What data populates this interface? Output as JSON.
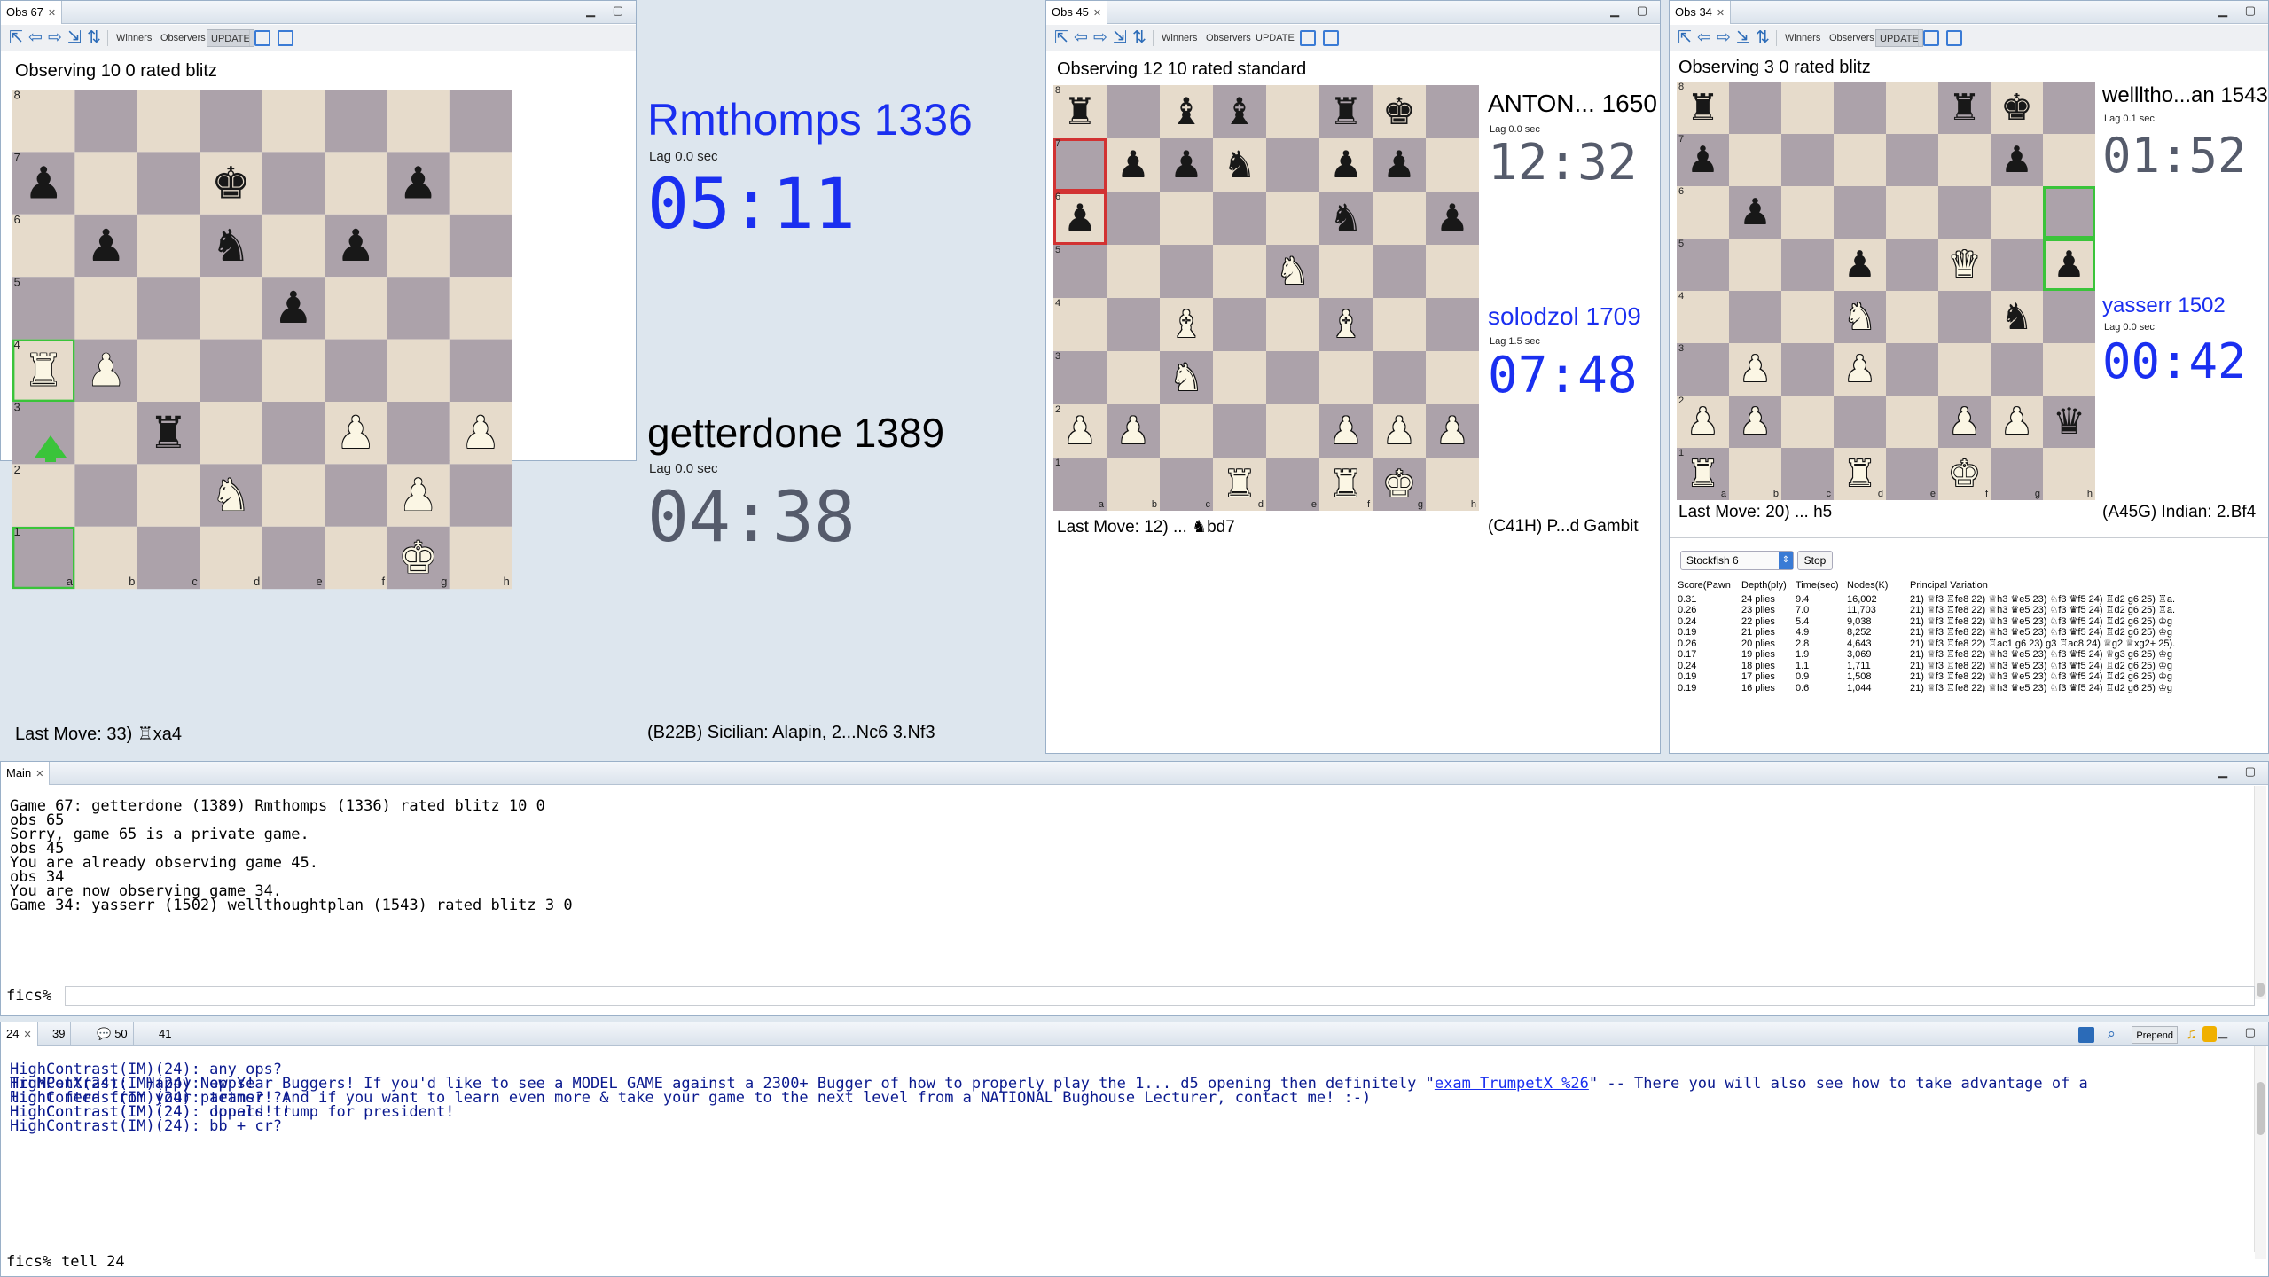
{
  "game1": {
    "tab_label": "Obs 67",
    "toolbar": {
      "winners": "Winners",
      "observers": "Observers",
      "update": "UPDATE"
    },
    "header": "Observing 10 0 rated blitz",
    "top_player": {
      "name": "Rmthomps 1336",
      "lag": "Lag 0.0 sec",
      "clock": "05:11"
    },
    "bottom_player": {
      "name": "getterdone 1389",
      "lag": "Lag 0.0 sec",
      "clock": "04:38"
    },
    "last_move": "Last Move: 33) ♖xa4",
    "opening": "(B22B) Sicilian: Alapin, 2...Nc6 3.Nf3",
    "board": [
      [
        "",
        "",
        "",
        "",
        "",
        "",
        "",
        ""
      ],
      [
        "p",
        "",
        "",
        "k",
        "",
        "",
        "p",
        ""
      ],
      [
        "",
        "p",
        "",
        "n",
        "",
        "p",
        "",
        ""
      ],
      [
        "",
        "",
        "",
        "",
        "p",
        "",
        "",
        ""
      ],
      [
        "R",
        "P",
        "",
        "",
        "",
        "",
        "",
        ""
      ],
      [
        "",
        "",
        "r",
        "",
        "",
        "P",
        "",
        "P"
      ],
      [
        "",
        "",
        "",
        "N",
        "",
        "",
        "P",
        ""
      ],
      [
        "",
        "",
        "",
        "",
        "",
        "",
        "K",
        ""
      ]
    ],
    "files": [
      "a",
      "b",
      "c",
      "d",
      "e",
      "f",
      "g",
      "h"
    ],
    "ranks": [
      "8",
      "7",
      "6",
      "5",
      "4",
      "3",
      "2",
      "1"
    ]
  },
  "game2": {
    "tab_label": "Obs 45",
    "toolbar": {
      "winners": "Winners",
      "observers": "Observers",
      "update": "UPDATE"
    },
    "header": "Observing 12 10 rated standard",
    "top_player": {
      "name": "ANTON... 1650",
      "lag": "Lag 0.0 sec",
      "clock": "12:32"
    },
    "bottom_player": {
      "name": "solodzol 1709",
      "lag": "Lag 1.5 sec",
      "clock": "07:48"
    },
    "last_move": "Last Move: 12) ... ♞bd7",
    "opening": "(C41H) P...d Gambit",
    "board": [
      [
        "r",
        "",
        "b",
        "b",
        "",
        "r",
        "k",
        ""
      ],
      [
        "",
        "p",
        "p",
        "n",
        "",
        "p",
        "p",
        ""
      ],
      [
        "p",
        "",
        "",
        "",
        "",
        "n",
        "",
        "p"
      ],
      [
        "",
        "",
        "",
        "",
        "N",
        "",
        "",
        ""
      ],
      [
        "",
        "",
        "B",
        "",
        "",
        "B",
        "",
        ""
      ],
      [
        "",
        "",
        "N",
        "",
        "",
        "",
        "",
        ""
      ],
      [
        "P",
        "P",
        "",
        "",
        "",
        "P",
        "P",
        "P"
      ],
      [
        "",
        "",
        "",
        "R",
        "",
        "R",
        "K",
        ""
      ]
    ],
    "files": [
      "a",
      "b",
      "c",
      "d",
      "e",
      "f",
      "g",
      "h"
    ],
    "ranks": [
      "8",
      "7",
      "6",
      "5",
      "4",
      "3",
      "2",
      "1"
    ]
  },
  "game3": {
    "tab_label": "Obs 34",
    "toolbar": {
      "winners": "Winners",
      "observers": "Observers",
      "update": "UPDATE"
    },
    "header": "Observing 3 0 rated blitz",
    "top_player": {
      "name": "wellltho...an 1543",
      "lag": "Lag 0.1 sec",
      "clock": "01:52"
    },
    "bottom_player": {
      "name": "yasserr 1502",
      "lag": "Lag 0.0 sec",
      "clock": "00:42"
    },
    "last_move": "Last Move: 20) ... h5",
    "opening": "(A45G) Indian: 2.Bf4",
    "board": [
      [
        "r",
        "",
        "",
        "",
        "",
        "r",
        "k",
        ""
      ],
      [
        "p",
        "",
        "",
        "",
        "",
        "",
        "p",
        ""
      ],
      [
        "",
        "p",
        "",
        "",
        "",
        "",
        "",
        ""
      ],
      [
        "",
        "",
        "",
        "p",
        "",
        "Q",
        "",
        "p"
      ],
      [
        "",
        "",
        "",
        "N",
        "",
        "",
        "n",
        ""
      ],
      [
        "",
        "P",
        "",
        "P",
        "",
        "",
        "",
        ""
      ],
      [
        "P",
        "P",
        "",
        "",
        "",
        "P",
        "P",
        "q"
      ],
      [
        "R",
        "",
        "",
        "R",
        "",
        "K",
        "",
        ""
      ]
    ],
    "files": [
      "a",
      "b",
      "c",
      "d",
      "e",
      "f",
      "g",
      "h"
    ],
    "ranks": [
      "8",
      "7",
      "6",
      "5",
      "4",
      "3",
      "2",
      "1"
    ]
  },
  "engine": {
    "name": "Stockfish 6",
    "stop": "Stop",
    "headers": [
      "Score(Pawn",
      "Depth(ply)",
      "Time(sec)",
      "Nodes(K)",
      "Principal Variation"
    ],
    "rows": [
      [
        "0.31",
        "24 plies",
        "9.4",
        "16,002",
        "21) ♕f3 ♖fe8 22) ♕h3 ♛e5 23) ♘f3 ♛f5 24) ♖d2 g6 25) ♖a."
      ],
      [
        "0.26",
        "23 plies",
        "7.0",
        "11,703",
        "21) ♕f3 ♖fe8 22) ♕h3 ♛e5 23) ♘f3 ♛f5 24) ♖d2 g6 25) ♖a."
      ],
      [
        "0.24",
        "22 plies",
        "5.4",
        "9,038",
        "21) ♕f3 ♖fe8 22) ♕h3 ♛e5 23) ♘f3 ♛f5 24) ♖d2 g6 25) ♔g"
      ],
      [
        "0.19",
        "21 plies",
        "4.9",
        "8,252",
        "21) ♕f3 ♖fe8 22) ♕h3 ♛e5 23) ♘f3 ♛f5 24) ♖d2 g6 25) ♔g"
      ],
      [
        "0.26",
        "20 plies",
        "2.8",
        "4,643",
        "21) ♕f3 ♖fe8 22) ♖ac1 g6 23) g3 ♖ac8 24) ♕g2 ♕xg2+ 25)."
      ],
      [
        "0.17",
        "19 plies",
        "1.9",
        "3,069",
        "21) ♕f3 ♖fe8 22) ♕h3 ♛e5 23) ♘f3 ♛f5 24) ♕g3 g6 25) ♔g"
      ],
      [
        "0.24",
        "18 plies",
        "1.1",
        "1,711",
        "21) ♕f3 ♖fe8 22) ♕h3 ♛e5 23) ♘f3 ♛f5 24) ♖d2 g6 25) ♔g"
      ],
      [
        "0.19",
        "17 plies",
        "0.9",
        "1,508",
        "21) ♕f3 ♖fe8 22) ♕h3 ♛e5 23) ♘f3 ♛f5 24) ♖d2 g6 25) ♔g"
      ],
      [
        "0.19",
        "16 plies",
        "0.6",
        "1,044",
        "21) ♕f3 ♖fe8 22) ♕h3 ♛e5 23) ♘f3 ♛f5 24) ♖d2 g6 25) ♔g"
      ]
    ]
  },
  "main": {
    "tab_label": "Main",
    "lines": [
      "Game 67: getterdone (1389) Rmthomps (1336) rated blitz 10 0",
      "obs 65",
      "Sorry, game 65 is a private game.",
      "obs 45",
      "You are already observing game 45.",
      "obs 34",
      "You are now observing game 34.",
      "Game 34: yasserr (1502) wellthoughtplan (1543) rated blitz 3 0"
    ],
    "prompt": "fics%",
    "input_value": ""
  },
  "channel": {
    "tabs": [
      "24",
      "39",
      "50",
      "41"
    ],
    "prepend": "Prepend",
    "lines": [
      "HighContrast(IM)(24): any ops?",
      "HighContrast(IM)(24): opps!",
      "HighContrast(IM)(24): teams?!?!",
      "HighContrast(IM)(24): oppers!!!",
      "HighContrast(IM)(24): bb + cr?"
    ],
    "trumpet_pre": "TruMPetX(24):  Happy New Year Buggers! If you'd like to see a MODEL GAME against a 2300+ Bugger of how to properly play the 1... d5 opening then definitely \"",
    "trumpet_link": "exam TrumpetX %26",
    "trumpet_post": "\" -- There you will also see how to take advantage of a",
    "trumpet_line2": "light feed from your partner! And if you want to learn even more & take your game to the next level from a NATIONAL Bughouse Lecturer, contact me! :-)",
    "last_line": "HighContrast(IM)(24): donald trump for president!",
    "prompt": "fics%",
    "input_value": "tell 24"
  },
  "colors": {
    "clock_active": "#1a2ff0",
    "clock_idle": "#555b6b",
    "highlight": "#3ac43a",
    "highlight_red": "#d23232",
    "board_light": "#e6dbcb",
    "board_dark": "#aca2aa"
  },
  "icons": [
    "back-icon",
    "rewind-icon",
    "forward-icon",
    "next-icon",
    "flip-icon",
    "calculator-icon",
    "grid-icon",
    "save-icon",
    "search-icon",
    "speech-icon",
    "music-icon",
    "lock-icon"
  ]
}
